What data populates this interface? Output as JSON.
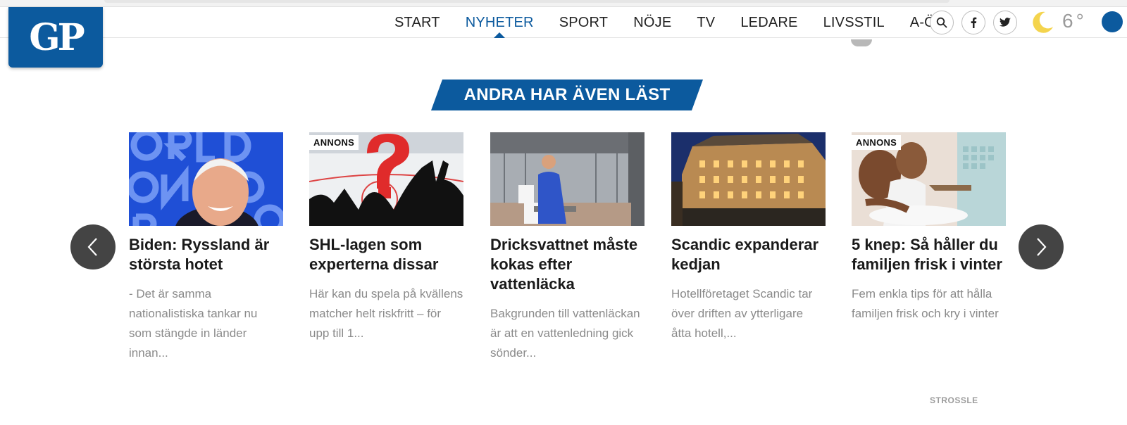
{
  "logo": {
    "text": "GP"
  },
  "nav": {
    "items": [
      {
        "label": "START"
      },
      {
        "label": "NYHETER",
        "active": true
      },
      {
        "label": "SPORT"
      },
      {
        "label": "NÖJE"
      },
      {
        "label": "TV"
      },
      {
        "label": "LEDARE"
      },
      {
        "label": "LIVSSTIL"
      },
      {
        "label": "A-Ö"
      }
    ],
    "icons": [
      "search-icon",
      "facebook-icon",
      "twitter-icon"
    ]
  },
  "weather": {
    "icon": "moon-icon",
    "temperature": "6°"
  },
  "section": {
    "title": "ANDRA HAR ÄVEN LÄST"
  },
  "cards": [
    {
      "image": "biden-photo",
      "badge": "",
      "title": "Biden: Ryssland är största hotet",
      "excerpt": "- Det är samma nationalistiska tankar nu som stängde in länder innan..."
    },
    {
      "image": "hockey-question-photo",
      "badge": "ANNONS",
      "title": "SHL-lagen som experterna dissar",
      "excerpt": "Här kan du spela på kvällens matcher helt riskfritt – för upp till 1..."
    },
    {
      "image": "water-hospital-photo",
      "badge": "",
      "title": "Dricksvattnet måste kokas efter vattenläcka",
      "excerpt": "Bakgrunden till vattenläckan är att en vattenledning gick sönder..."
    },
    {
      "image": "hotel-night-photo",
      "badge": "",
      "title": "Scandic expanderar kedjan",
      "excerpt": "Hotellföretaget Scandic tar över driften av ytterligare åtta hotell,..."
    },
    {
      "image": "child-handwash-photo",
      "badge": "ANNONS",
      "title": "5 knep: Så håller du familjen frisk i vinter",
      "excerpt": "Fem enkla tips för att hålla familjen frisk och kry i vinter"
    }
  ],
  "credit": {
    "text": "STROSSLE"
  },
  "colors": {
    "brand": "#0c5a9e",
    "arrow": "#444444"
  }
}
